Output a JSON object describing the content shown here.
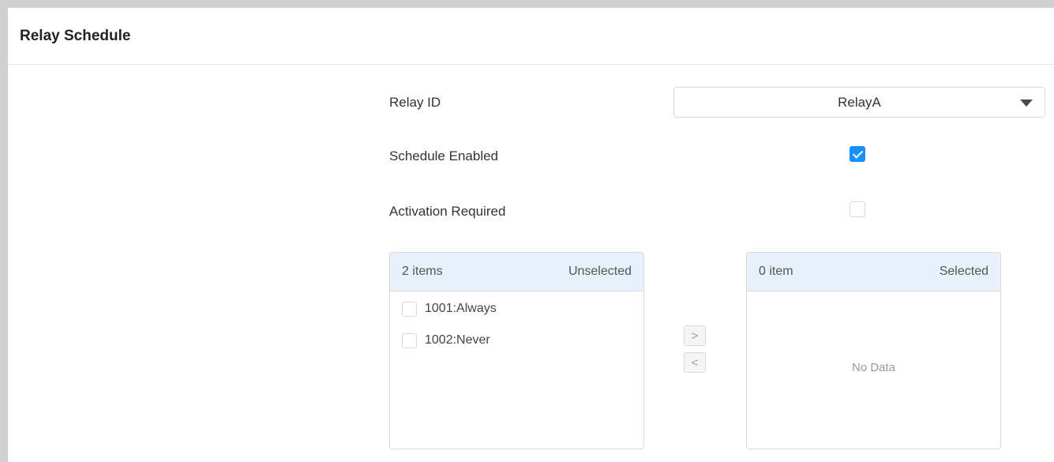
{
  "panel": {
    "title": "Relay Schedule"
  },
  "form": {
    "relay_id": {
      "label": "Relay ID",
      "value": "RelayA"
    },
    "schedule_enabled": {
      "label": "Schedule Enabled",
      "checked": true
    },
    "activation_required": {
      "label": "Activation Required",
      "checked": false
    }
  },
  "transfer": {
    "source": {
      "count": "2 items",
      "title": "Unselected",
      "items": [
        {
          "label": "1001:Always",
          "checked": false
        },
        {
          "label": "1002:Never",
          "checked": false
        }
      ]
    },
    "target": {
      "count": "0 item",
      "title": "Selected",
      "empty_text": "No Data"
    },
    "move_right_label": ">",
    "move_left_label": "<"
  },
  "colors": {
    "accent": "#1890ff",
    "list_header_bg": "#e6f1fc",
    "page_border": "#cfcfcf"
  },
  "icons": {
    "dropdown": "caret-down-icon",
    "check": "check-icon"
  }
}
